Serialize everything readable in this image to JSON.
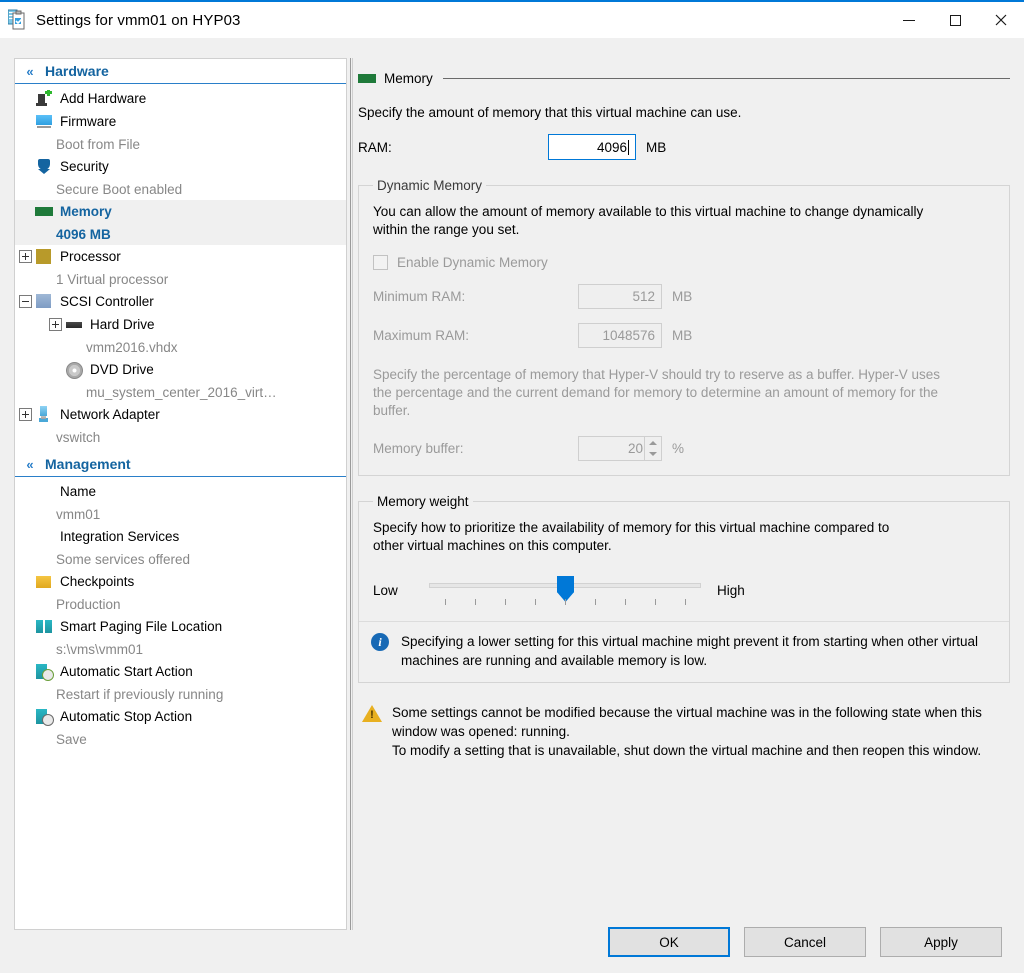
{
  "window": {
    "title": "Settings for vmm01 on HYP03",
    "icon": "settings-vm-icon",
    "minimize": "–",
    "maximize": "□",
    "close": "✕"
  },
  "sidebar": {
    "groups": [
      {
        "label": "Hardware",
        "chevron": "«",
        "items": [
          {
            "label": "Add Hardware",
            "sub": "",
            "icon": "add-hardware-icon",
            "expander": "none"
          },
          {
            "label": "Firmware",
            "sub": "Boot from File",
            "icon": "firmware-icon",
            "expander": "none"
          },
          {
            "label": "Security",
            "sub": "Secure Boot enabled",
            "icon": "security-icon",
            "expander": "none"
          },
          {
            "label": "Memory",
            "sub": "4096 MB",
            "icon": "memory-icon",
            "expander": "none",
            "selected": true
          },
          {
            "label": "Processor",
            "sub": "1 Virtual processor",
            "icon": "processor-icon",
            "expander": "plus"
          },
          {
            "label": "SCSI Controller",
            "sub": "",
            "icon": "scsi-controller-icon",
            "expander": "minus"
          },
          {
            "label": "Hard Drive",
            "sub": "vmm2016.vhdx",
            "icon": "hard-drive-icon",
            "expander": "plus",
            "indent": 1
          },
          {
            "label": "DVD Drive",
            "sub": "mu_system_center_2016_virt…",
            "icon": "dvd-drive-icon",
            "expander": "none",
            "indent": 1
          },
          {
            "label": "Network Adapter",
            "sub": "vswitch",
            "icon": "network-adapter-icon",
            "expander": "plus"
          }
        ]
      },
      {
        "label": "Management",
        "chevron": "«",
        "items": [
          {
            "label": "Name",
            "sub": "vmm01",
            "icon": "name-icon",
            "expander": "none"
          },
          {
            "label": "Integration Services",
            "sub": "Some services offered",
            "icon": "integration-services-icon",
            "expander": "none"
          },
          {
            "label": "Checkpoints",
            "sub": "Production",
            "icon": "checkpoints-icon",
            "expander": "none"
          },
          {
            "label": "Smart Paging File Location",
            "sub": "s:\\vms\\vmm01",
            "icon": "smart-paging-icon",
            "expander": "none"
          },
          {
            "label": "Automatic Start Action",
            "sub": "Restart if previously running",
            "icon": "automatic-start-icon",
            "expander": "none"
          },
          {
            "label": "Automatic Stop Action",
            "sub": "Save",
            "icon": "automatic-stop-icon",
            "expander": "none"
          }
        ]
      }
    ]
  },
  "panel": {
    "title": "Memory",
    "icon": "memory-icon",
    "description": "Specify the amount of memory that this virtual machine can use.",
    "ram": {
      "label": "RAM:",
      "value": "4096",
      "unit": "MB"
    },
    "dynamic_memory": {
      "legend": "Dynamic Memory",
      "description": "You can allow the amount of memory available to this virtual machine to change dynamically within the range you set.",
      "enable_label": "Enable Dynamic Memory",
      "enable_checked": false,
      "minimum_label": "Minimum RAM:",
      "minimum_value": "512",
      "minimum_unit": "MB",
      "maximum_label": "Maximum RAM:",
      "maximum_value": "1048576",
      "maximum_unit": "MB",
      "buffer_description": "Specify the percentage of memory that Hyper-V should try to reserve as a buffer. Hyper-V uses the percentage and the current demand for memory to determine an amount of memory for the buffer.",
      "buffer_label": "Memory buffer:",
      "buffer_value": "20",
      "buffer_unit": "%"
    },
    "memory_weight": {
      "legend": "Memory weight",
      "description": "Specify how to prioritize the availability of memory for this virtual machine compared to other virtual machines on this computer.",
      "low_label": "Low",
      "high_label": "High",
      "ticks": 9,
      "value_index": 4,
      "info_icon": "info-icon",
      "info_text": "Specifying a lower setting for this virtual machine might prevent it from starting when other virtual machines are running and available memory is low."
    },
    "warning": {
      "icon": "warning-icon",
      "line1": "Some settings cannot be modified because the virtual machine was in the following state when this window was opened: running.",
      "line2": "To modify a setting that is unavailable, shut down the virtual machine and then reopen this window."
    }
  },
  "footer": {
    "ok": "OK",
    "cancel": "Cancel",
    "apply": "Apply"
  },
  "colors": {
    "accent": "#0078d7",
    "group_header": "#1464a0",
    "sub_text": "#878787",
    "disabled": "#9a9a9a",
    "warning": "#e8b020",
    "info": "#1769b5"
  }
}
